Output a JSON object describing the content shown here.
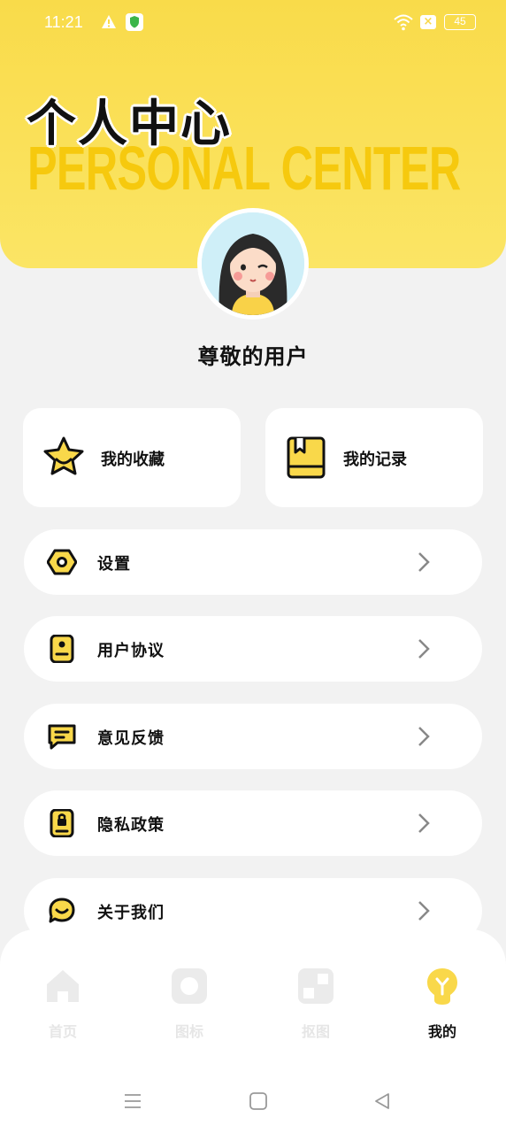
{
  "status_bar": {
    "time": "11:21",
    "battery": "45"
  },
  "header": {
    "title_cn": "个人中心",
    "title_en": "PERSONAL CENTER"
  },
  "profile": {
    "username": "尊敬的用户"
  },
  "quick_actions": [
    {
      "label": "我的收藏",
      "icon": "star-icon"
    },
    {
      "label": "我的记录",
      "icon": "book-icon"
    }
  ],
  "menu": [
    {
      "label": "设置",
      "icon": "settings-icon"
    },
    {
      "label": "用户协议",
      "icon": "agreement-icon"
    },
    {
      "label": "意见反馈",
      "icon": "feedback-icon"
    },
    {
      "label": "隐私政策",
      "icon": "privacy-icon"
    },
    {
      "label": "关于我们",
      "icon": "about-icon"
    }
  ],
  "tabs": [
    {
      "label": "首页",
      "icon": "home-icon",
      "active": false
    },
    {
      "label": "图标",
      "icon": "icon-tab-icon",
      "active": false
    },
    {
      "label": "抠图",
      "icon": "cutout-icon",
      "active": false
    },
    {
      "label": "我的",
      "icon": "lightbulb-icon",
      "active": true
    }
  ],
  "colors": {
    "accent": "#f9db4a",
    "background": "#f2f2f2",
    "text": "#111111",
    "inactive_tab": "#e6e6e6"
  }
}
